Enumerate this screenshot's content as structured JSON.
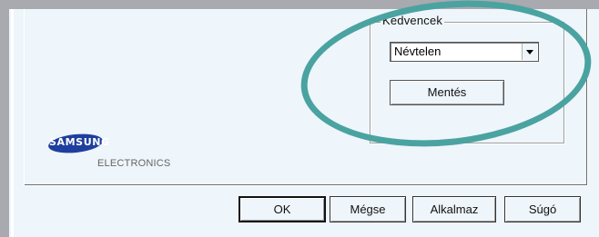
{
  "favorites": {
    "group_title": "Kedvencek",
    "selected_value": "Névtelen",
    "save_label": "Mentés"
  },
  "logo": {
    "brand": "SAMSUNG",
    "sub": "ELECTRONICS"
  },
  "footer": {
    "ok_label": "OK",
    "cancel_label": "Mégse",
    "apply_label": "Alkalmaz",
    "help_label": "Súgó"
  },
  "colors": {
    "dialog_bg": "#eef5fb",
    "highlight": "#4aa3a0",
    "logo_blue": "#1f3f9e"
  }
}
